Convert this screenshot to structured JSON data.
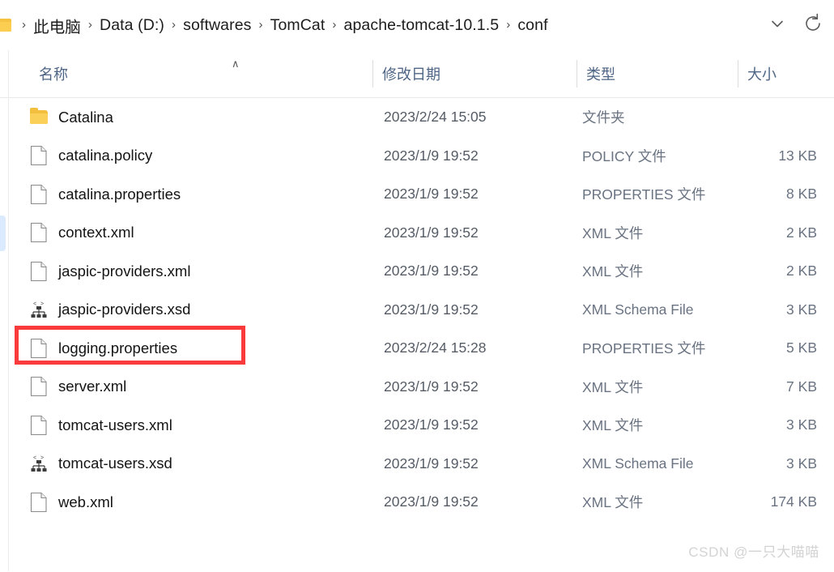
{
  "address_bar": {
    "folder_icon": "folder-icon",
    "separator": "›",
    "breadcrumbs": [
      "此电脑",
      "Data (D:)",
      "softwares",
      "TomCat",
      "apache-tomcat-10.1.5",
      "conf"
    ],
    "history_dropdown_icon": "chevron-down-icon",
    "refresh_icon": "refresh-icon"
  },
  "columns": {
    "name": "名称",
    "date_modified": "修改日期",
    "type": "类型",
    "size": "大小",
    "sort_indicator": "∧"
  },
  "files": [
    {
      "name": "Catalina",
      "icon": "folder-icon",
      "date": "2023/2/24 15:05",
      "type": "文件夹",
      "size": ""
    },
    {
      "name": "catalina.policy",
      "icon": "file-icon",
      "date": "2023/1/9 19:52",
      "type": "POLICY 文件",
      "size": "13 KB"
    },
    {
      "name": "catalina.properties",
      "icon": "file-icon",
      "date": "2023/1/9 19:52",
      "type": "PROPERTIES 文件",
      "size": "8 KB"
    },
    {
      "name": "context.xml",
      "icon": "file-icon",
      "date": "2023/1/9 19:52",
      "type": "XML 文件",
      "size": "2 KB"
    },
    {
      "name": "jaspic-providers.xml",
      "icon": "file-icon",
      "date": "2023/1/9 19:52",
      "type": "XML 文件",
      "size": "2 KB"
    },
    {
      "name": "jaspic-providers.xsd",
      "icon": "xsd-schema-icon",
      "date": "2023/1/9 19:52",
      "type": "XML Schema File",
      "size": "3 KB"
    },
    {
      "name": "logging.properties",
      "icon": "file-icon",
      "date": "2023/2/24 15:28",
      "type": "PROPERTIES 文件",
      "size": "5 KB"
    },
    {
      "name": "server.xml",
      "icon": "file-icon",
      "date": "2023/1/9 19:52",
      "type": "XML 文件",
      "size": "7 KB"
    },
    {
      "name": "tomcat-users.xml",
      "icon": "file-icon",
      "date": "2023/1/9 19:52",
      "type": "XML 文件",
      "size": "3 KB"
    },
    {
      "name": "tomcat-users.xsd",
      "icon": "xsd-schema-icon",
      "date": "2023/1/9 19:52",
      "type": "XML Schema File",
      "size": "3 KB"
    },
    {
      "name": "web.xml",
      "icon": "file-icon",
      "date": "2023/1/9 19:52",
      "type": "XML 文件",
      "size": "174 KB"
    }
  ],
  "annotation": {
    "target_row_index": 6,
    "target_row_name": "logging.properties",
    "color": "#fb3b3b"
  },
  "watermark": "CSDN @一只大喵喵",
  "colors": {
    "header_text": "#4e6585",
    "meta_text": "#6a7382",
    "name_text": "#141414",
    "folder_yellow": "#fbd058",
    "rail_selection": "#dbeafe",
    "annotation_red": "#fb3b3b"
  }
}
